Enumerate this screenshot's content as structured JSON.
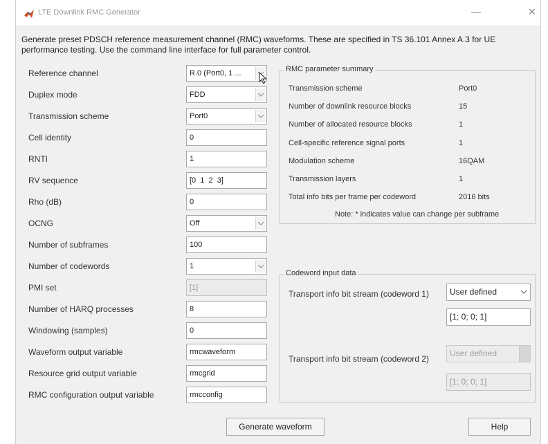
{
  "window": {
    "title": "LTE Downlink RMC Generator",
    "minimize_glyph": "—",
    "close_glyph": "✕"
  },
  "description": "Generate preset PDSCH reference measurement channel (RMC) waveforms. These are specified in TS 36.101 Annex A.3 for UE performance testing. Use the command line interface for full parameter control.",
  "form": {
    "reference_channel": {
      "label": "Reference channel",
      "value": "R.0 (Port0, 1 ..."
    },
    "duplex_mode": {
      "label": "Duplex mode",
      "value": "FDD"
    },
    "transmission_scheme": {
      "label": "Transmission scheme",
      "value": "Port0"
    },
    "cell_identity": {
      "label": "Cell identity",
      "value": "0"
    },
    "rnti": {
      "label": "RNTI",
      "value": "1"
    },
    "rv_sequence": {
      "label": "RV sequence",
      "value": "[0  1  2  3]"
    },
    "rho": {
      "label": "Rho (dB)",
      "value": "0"
    },
    "ocng": {
      "label": "OCNG",
      "value": "Off"
    },
    "num_subframes": {
      "label": "Number of subframes",
      "value": "100"
    },
    "num_codewords": {
      "label": "Number of codewords",
      "value": "1"
    },
    "pmi_set": {
      "label": "PMI set",
      "value": "[1]"
    },
    "harq_processes": {
      "label": "Number of HARQ processes",
      "value": "8"
    },
    "windowing": {
      "label": "Windowing (samples)",
      "value": "0"
    },
    "waveform_var": {
      "label": "Waveform output variable",
      "value": "rmcwaveform"
    },
    "grid_var": {
      "label": "Resource grid output variable",
      "value": "rmcgrid"
    },
    "config_var": {
      "label": "RMC configuration output variable",
      "value": "rmcconfig"
    }
  },
  "summary": {
    "title": "RMC parameter summary",
    "rows": [
      {
        "label": "Transmission scheme",
        "value": "Port0"
      },
      {
        "label": "Number of downlink resource blocks",
        "value": "15"
      },
      {
        "label": "Number of allocated resource blocks",
        "value": "1"
      },
      {
        "label": "Cell-specific reference signal ports",
        "value": "1"
      },
      {
        "label": "Modulation scheme",
        "value": "16QAM"
      },
      {
        "label": "Transmission layers",
        "value": "1"
      },
      {
        "label": "Total info bits per frame per codeword",
        "value": "2016 bits"
      }
    ],
    "note": "Note: * indicates value can change per subframe"
  },
  "codeword": {
    "title": "Codeword input data",
    "cw1_label": "Transport info bit stream (codeword 1)",
    "cw1_mode": "User defined",
    "cw1_value": "[1; 0; 0; 1]",
    "cw2_label": "Transport info bit stream (codeword 2)",
    "cw2_mode": "User defined",
    "cw2_value": "[1; 0; 0; 1]"
  },
  "buttons": {
    "generate": "Generate waveform",
    "help": "Help"
  },
  "icons": {
    "app": "matlab-logo-icon",
    "dropdown": "chevron-down-icon",
    "cursor": "mouse-pointer-icon"
  },
  "colors": {
    "window_bg": "#f0f0f0",
    "titlebar_bg": "#ffffff",
    "field_border": "#a8a8a8",
    "disabled_bg": "#ebebeb"
  }
}
